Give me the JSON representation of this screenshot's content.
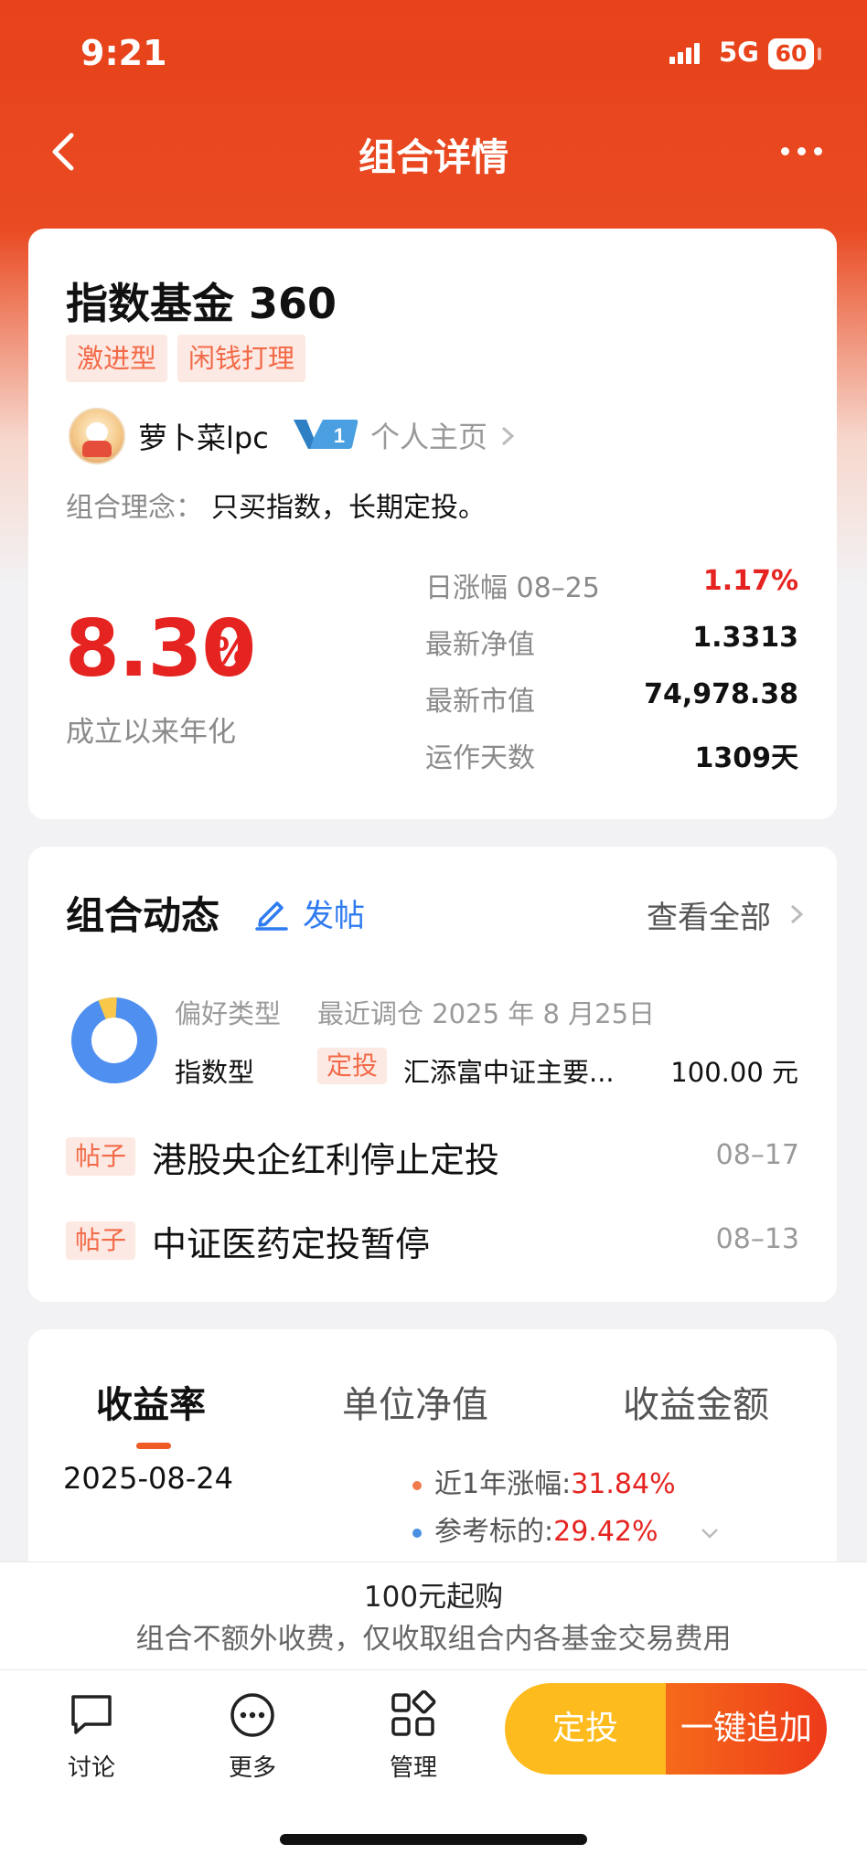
{
  "status_bar": {
    "time": "9:21",
    "network": "5G",
    "battery": "60"
  },
  "nav": {
    "title": "组合详情"
  },
  "portfolio": {
    "name": "指数基金 360",
    "tags": [
      "激进型",
      "闲钱打理"
    ],
    "user": {
      "name": "萝卜菜lpc",
      "level": "1",
      "homepage_label": "个人主页"
    },
    "philosophy_label": "组合理念：",
    "philosophy_text": "只买指数，长期定投。",
    "annual_rate": "8.30",
    "annual_rate_unit": "%",
    "annual_rate_label": "成立以来年化",
    "stats": [
      {
        "label": "日涨幅 08–25",
        "value": "1.17%",
        "color": "#e52421"
      },
      {
        "label": "最新净值",
        "value": "1.3313"
      },
      {
        "label": "最新市值",
        "value": "74,978.38"
      },
      {
        "label": "运作天数",
        "value": "1309天"
      }
    ]
  },
  "activity": {
    "title": "组合动态",
    "post_button": "发帖",
    "view_all": "查看全部",
    "preference_label": "偏好类型",
    "preference_value": "指数型",
    "rebalance_label": "最近调仓 2025 年 8 月25日",
    "rebalance_tag": "定投",
    "rebalance_fund": "汇添富中证主要...",
    "rebalance_amount": "100.00 元",
    "posts": [
      {
        "tag": "帖子",
        "title": "港股央企红利停止定投",
        "date": "08–17"
      },
      {
        "tag": "帖子",
        "title": "中证医药定投暂停",
        "date": "08–13"
      }
    ]
  },
  "returns": {
    "tabs": [
      "收益率",
      "单位净值",
      "收益金额"
    ],
    "active_tab": "收益率",
    "date": "2025-08-24",
    "legend": [
      {
        "label": "近1年涨幅:",
        "value": "31.84%",
        "color": "#f07a4a"
      },
      {
        "label": "参考标的:",
        "value": "29.42%",
        "color": "#4a90e2"
      }
    ]
  },
  "notice": {
    "line1": "100元起购",
    "line2": "组合不额外收费，仅收取组合内各基金交易费用"
  },
  "bottom_bar": {
    "items": [
      {
        "label": "讨论",
        "icon": "chat-icon"
      },
      {
        "label": "更多",
        "icon": "more-icon"
      },
      {
        "label": "管理",
        "icon": "manage-icon"
      }
    ],
    "cta_left": "定投",
    "cta_right": "一键追加"
  },
  "colors": {
    "brand": "#e8421a",
    "up": "#e52421",
    "accent_blue": "#2f7bf0",
    "cta_yellow": "#fdbb1e"
  }
}
